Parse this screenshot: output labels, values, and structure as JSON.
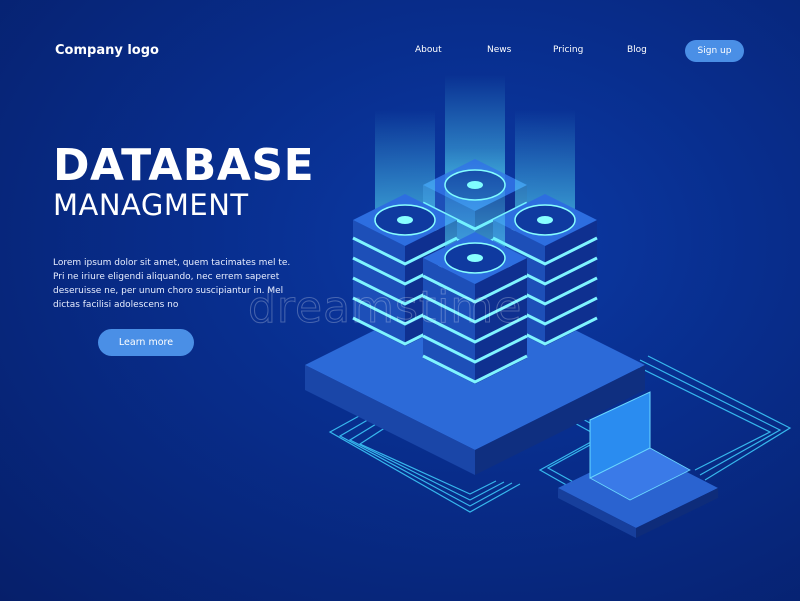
{
  "nav": {
    "logo": "Company logo",
    "links": [
      "About",
      "News",
      "Pricing",
      "Blog"
    ],
    "signup": "Sign up"
  },
  "hero": {
    "title": "DATABASE",
    "subtitle": "MANAGMENT",
    "body": "Lorem ipsum dolor sit amet, quem tacimates mel te. Pri ne iriure eligendi aliquando, nec errem saperet deseruisse ne, per unum choro suscipiantur in. Mel dictas facilisi adolescens no",
    "cta": "Learn more"
  },
  "watermark": "dreamstime",
  "colors": {
    "accent": "#4a8fe6",
    "glow": "#5ff0ff",
    "bg": "#0a2f90"
  }
}
